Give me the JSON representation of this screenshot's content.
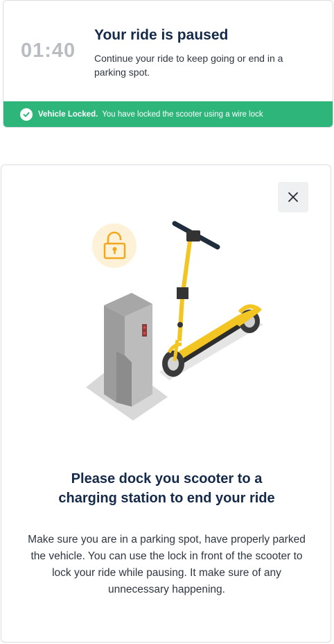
{
  "ride_card": {
    "timer": "01:40",
    "title": "Your ride is paused",
    "subtitle": "Continue your ride to keep going or end in a parking spot."
  },
  "status_banner": {
    "label": "Vehicle Locked.",
    "message": "You have locked the scooter using a wire lock",
    "color": "#2db57a"
  },
  "modal": {
    "close_icon": "close-icon",
    "title_line1": "Please dock you scooter to a",
    "title_line2": "charging station to end your ride",
    "body": "Make sure you are in a parking spot, have properly parked the vehicle. You can use the lock in front of the scooter to lock your ride while pausing. It make sure of any unnecessary happening."
  },
  "colors": {
    "heading": "#152948",
    "scooter_yellow": "#f2c523",
    "lock_bg": "#fdf1d8",
    "lock_icon": "#f2a81d"
  }
}
